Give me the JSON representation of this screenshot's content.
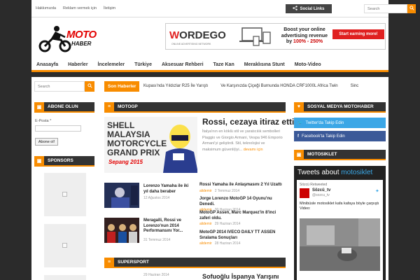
{
  "topbar": {
    "links": [
      "Hakkımızda",
      "Reklam vermek için",
      "İletişim"
    ],
    "social_label": "Social Links",
    "search_placeholder": "Search"
  },
  "logo": {
    "line1": "MOTO",
    "line2": "HABER"
  },
  "banner": {
    "brand_w": "W",
    "brand_rest": "ORDEGO",
    "sub": "ONLINE ADVERTISING NETWORK",
    "line1": "Boost your online",
    "line2": "advertising revenue",
    "line3_pre": "by ",
    "line3_pct": "100% - 250%",
    "cta": "Start earning more!"
  },
  "nav": {
    "items": [
      "Anasayfa",
      "Haberler",
      "İncelemeler",
      "Türkiye",
      "Aksesuar Rehberi",
      "Taze Kan",
      "Meraklısına Stunt",
      "Moto-Video"
    ]
  },
  "left": {
    "search_placeholder": "Search",
    "abone_title": "ABONE OLUN",
    "email_label": "E-Posta *",
    "abone_button": "Abone ol!",
    "sponsors_title": "SPONSORS"
  },
  "ticker": {
    "label": "Son Haberler",
    "items": [
      "Kupası'nda Yıldızlar R25 İle Yarıştı",
      "Ve Karşınızda Çiçeği Burnunda HONDA CRF1000L Africa Twin",
      "Sinc"
    ]
  },
  "motogp": {
    "title": "MOTOGP",
    "feat_image_text": "SHELL MALAYSIA MOTORCYCLE GRAND PRIX",
    "feat_image_date": "Sepang 2015",
    "feat_title": "Rossi, cezaya itiraz etti.",
    "feat_desc": "İtalya'nın en köklü stil ve yaratıcılık sembolleri Piaggio ve Giorgio Armani, Vespa 946 Emporio Armani'yi geliştirdi. Stil, teknolojisi ve maksimum güvenli(iyi...",
    "feat_more": "devamı için",
    "small": [
      {
        "title": "Lorenzo Yamaha ile iki yıl daha beraber",
        "date": "12 Ağustos 2014"
      },
      {
        "title": "Meragalli, Rossi ve Lorenzo'nun 2014 Performansını Yor...",
        "date": "31 Temmuz 2014"
      }
    ],
    "list": [
      {
        "title": "Rossi Yamaha ile Anlaşmasını 2 Yıl Uzattı",
        "author": "alidemir",
        "date": "2 Temmuz 2014"
      },
      {
        "title": "Jorge Lorenzo MotoGP 14 Oyunu'nu Denedi.",
        "author": "alidemir",
        "date": "30 Haziran 2014"
      },
      {
        "title": "MotoGP Assen, Marc Marquez'in 8'inci zaferi oldu.",
        "author": "alidemir",
        "date": "29 Haziran 2014"
      },
      {
        "title": "MotoGP 2014 IVECO DAILY TT ASSEN Sıralama Sonuçları",
        "author": "alidemir",
        "date": "28 Haziran 2014"
      }
    ]
  },
  "supersport": {
    "title": "SUPERSPORT",
    "date": "29 Haziran 2014",
    "item_title": "Sofuoğlu İspanya Yarışını"
  },
  "right": {
    "social_title": "SOSYAL MEDYA MOTOHABER",
    "twitter": "Twitter'da Takip Edin",
    "facebook": "Facebook'ta Takip Edin",
    "motosiklet_title": "MOTOSIKLET",
    "tweets_pre": "Tweets about ",
    "tweets_query": "motosiklet",
    "tw_retweet": "Sözcü Retweeted",
    "tw_name": "Sözcü_tv",
    "tw_handle": "@sozcu_tv",
    "tw_body": "Minibüsle motosiklet kafa kafaya böyle çarpıştı\nVideo:"
  },
  "colors": {
    "accent": "#f88c00",
    "dark": "#333333",
    "twitter": "#3ba7e6",
    "facebook": "#3b5998",
    "logo_red": "#e30000"
  }
}
